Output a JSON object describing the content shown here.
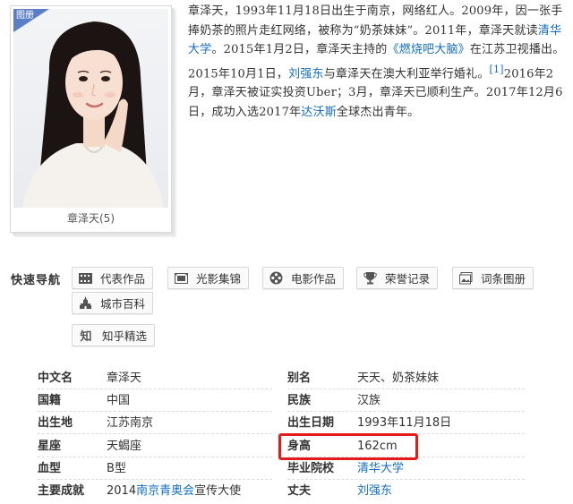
{
  "album": {
    "badge": "图册",
    "caption": "章泽天(5)"
  },
  "summary": {
    "t1": "章泽天，1993年11月18日出生于南京，网络红人。2009年，因一张手捧奶茶的照片走红网络，被称为“奶茶妹妹”。2011年，章泽天就读",
    "l1": "清华大学",
    "t2": "。2015年1月2日，章泽天主持的",
    "l2": "《燃烧吧大脑》",
    "t3": "在江苏卫视播出。2015年10月1日，",
    "l3": "刘强东",
    "t4": "与章泽天在澳大利亚举行婚礼。",
    "ref": "[1]",
    "t5": "2016年2月，章泽天被证实投资Uber；3月，章泽天已顺利生产。2017年12月6日，成功入选2017年",
    "l4": "达沃斯",
    "t6": "全球杰出青年。"
  },
  "quick_nav": {
    "title": "快速导航",
    "items": [
      {
        "label": "代表作品",
        "icon": "film-strip-icon"
      },
      {
        "label": "光影集锦",
        "icon": "photo-gallery-icon"
      },
      {
        "label": "电影作品",
        "icon": "film-reel-icon"
      },
      {
        "label": "荣誉记录",
        "icon": "trophy-icon"
      },
      {
        "label": "词条图册",
        "icon": "album-icon"
      },
      {
        "label": "城市百科",
        "icon": "city-building-icon"
      },
      {
        "label": "知乎精选",
        "icon": "zhihu-logo-icon"
      }
    ]
  },
  "info": {
    "rows": [
      {
        "k1": "中文名",
        "v1": "章泽天",
        "k2": "别名",
        "v2": "天天、奶茶妹妹"
      },
      {
        "k1": "国籍",
        "v1": "中国",
        "k2": "民族",
        "v2": "汉族"
      },
      {
        "k1": "出生地",
        "v1": "江苏南京",
        "k2": "出生日期",
        "v2": "1993年11月18日"
      },
      {
        "k1": "星座",
        "v1": "天蝎座",
        "k2": "身高",
        "v2": "162cm"
      },
      {
        "k1": "血型",
        "v1": "B型",
        "k2": "毕业院校",
        "v2": "清华大学"
      },
      {
        "k1": "主要成就",
        "v1_pre": "2014",
        "v1_link": "南京青奥会",
        "v1_post": "宣传大使",
        "k2": "丈夫",
        "v2": "刘强东"
      }
    ]
  },
  "colors": {
    "link": "#136ec2",
    "highlight": "#e31b1b",
    "badge": "#5b7fc6"
  }
}
